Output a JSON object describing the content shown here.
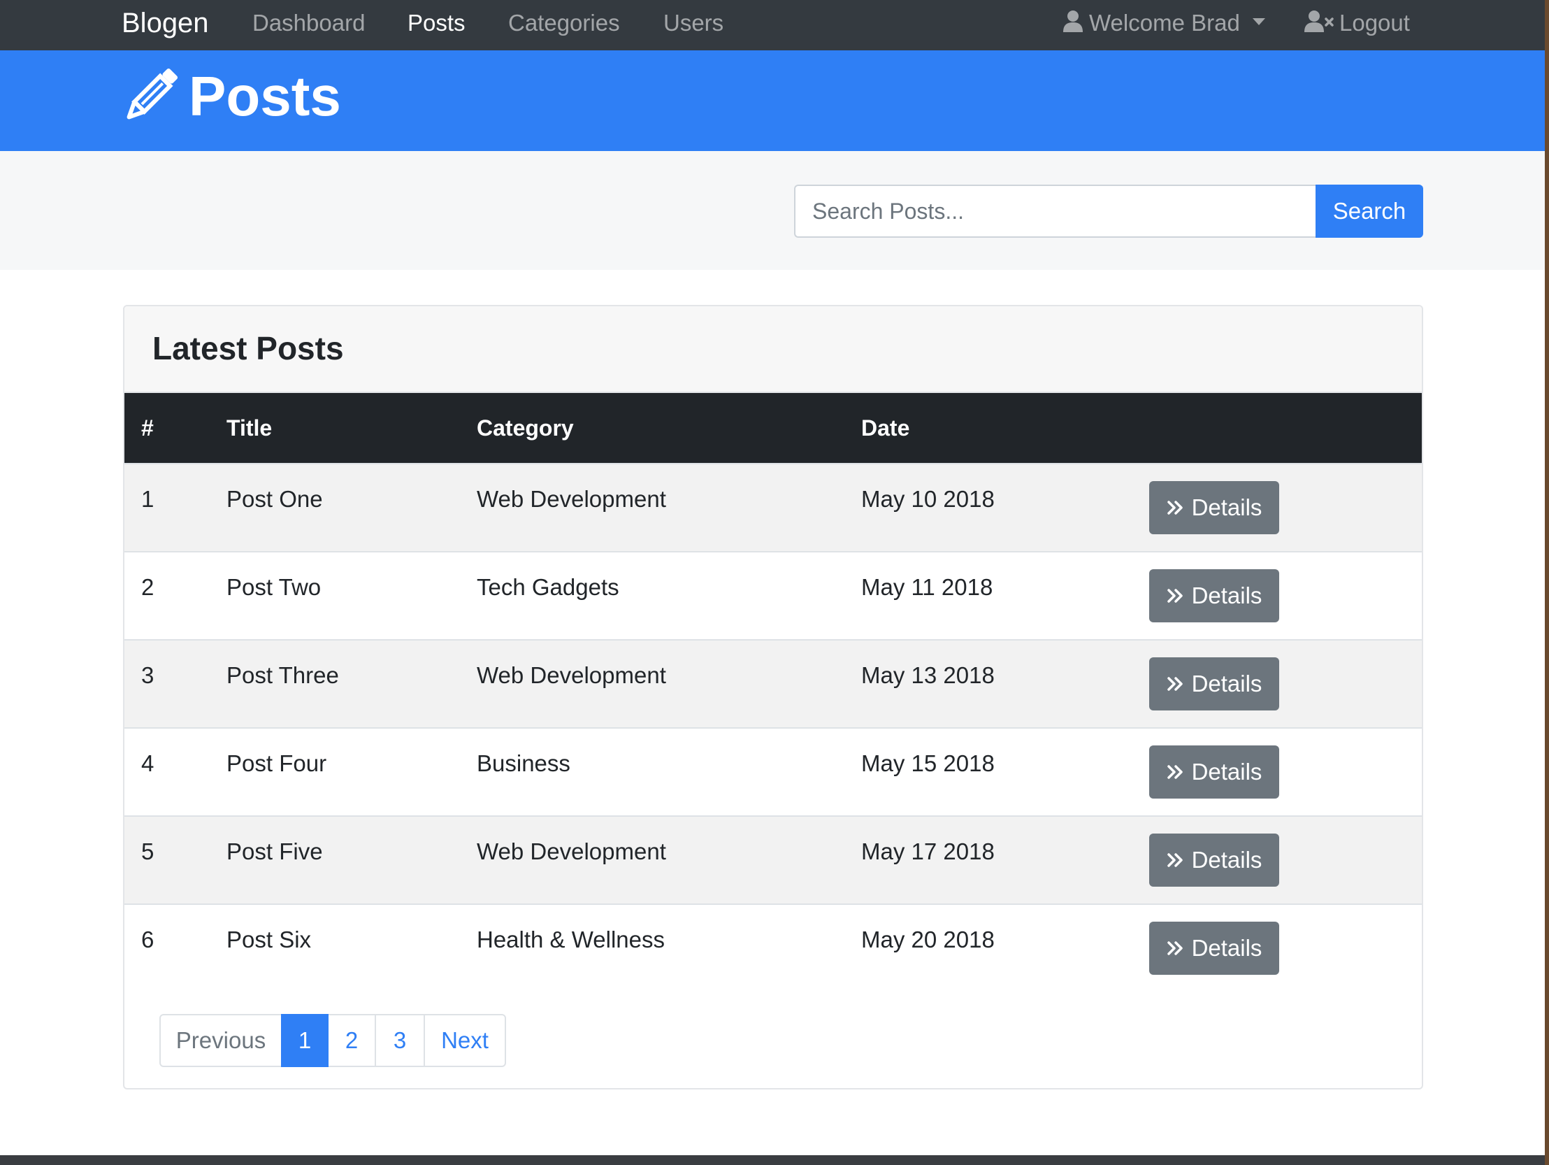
{
  "navbar": {
    "brand": "Blogen",
    "links": [
      {
        "label": "Dashboard",
        "active": false
      },
      {
        "label": "Posts",
        "active": true
      },
      {
        "label": "Categories",
        "active": false
      },
      {
        "label": "Users",
        "active": false
      }
    ],
    "user_menu": {
      "label": "Welcome Brad",
      "icon": "user-icon"
    },
    "logout": {
      "label": "Logout",
      "icon": "user-times-icon"
    }
  },
  "header": {
    "icon": "pencil-icon",
    "title": "Posts"
  },
  "search": {
    "placeholder": "Search Posts...",
    "value": "",
    "button_label": "Search"
  },
  "posts_card": {
    "title": "Latest Posts",
    "columns": [
      "#",
      "Title",
      "Category",
      "Date"
    ],
    "rows": [
      {
        "num": "1",
        "title": "Post One",
        "category": "Web Development",
        "date": "May 10 2018",
        "action": "Details"
      },
      {
        "num": "2",
        "title": "Post Two",
        "category": "Tech Gadgets",
        "date": "May 11 2018",
        "action": "Details"
      },
      {
        "num": "3",
        "title": "Post Three",
        "category": "Web Development",
        "date": "May 13 2018",
        "action": "Details"
      },
      {
        "num": "4",
        "title": "Post Four",
        "category": "Business",
        "date": "May 15 2018",
        "action": "Details"
      },
      {
        "num": "5",
        "title": "Post Five",
        "category": "Web Development",
        "date": "May 17 2018",
        "action": "Details"
      },
      {
        "num": "6",
        "title": "Post Six",
        "category": "Health & Wellness",
        "date": "May 20 2018",
        "action": "Details"
      }
    ],
    "details_icon": "angle-double-right-icon"
  },
  "pagination": {
    "previous": "Previous",
    "pages": [
      "1",
      "2",
      "3"
    ],
    "current_page": "1",
    "next": "Next"
  },
  "colors": {
    "navbar": "#343a40",
    "primary": "#2f7ff5",
    "secondary": "#6c757d",
    "table_header": "#212529"
  }
}
